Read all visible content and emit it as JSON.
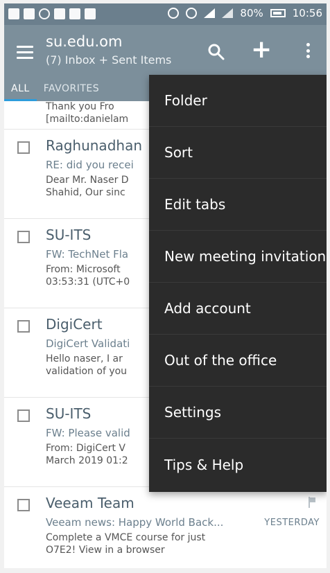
{
  "status_bar": {
    "battery": "80%",
    "time": "10:56",
    "icons": [
      "flipboard-icon",
      "flipboard-icon",
      "whatsapp-icon",
      "message-icon",
      "gmail-icon",
      "email-icon",
      "alarm-icon",
      "wifi-icon",
      "signal-icon",
      "signal-icon",
      "battery-icon"
    ]
  },
  "app_bar": {
    "account": "su.edu.om",
    "mailbox": "(7) Inbox + Sent Items",
    "icons": [
      "menu-icon",
      "search-icon",
      "add-icon",
      "more-vert-icon"
    ]
  },
  "tabs": [
    {
      "label": "ALL",
      "active": true
    },
    {
      "label": "FAVORITES",
      "active": false
    }
  ],
  "messages": {
    "partial": {
      "line1": "Thank you    Fro",
      "line2": "[mailto:danielam"
    },
    "items": [
      {
        "sender": "Raghunadhan",
        "subject": "RE: did you recei",
        "preview1": "Dear Mr. Naser D",
        "preview2": "Shahid,   Our sinc"
      },
      {
        "sender": "SU-ITS",
        "subject": "FW: TechNet Fla",
        "preview1": "From: Microsoft",
        "preview2": "03:53:31 (UTC+0"
      },
      {
        "sender": "DigiCert",
        "subject": "DigiCert Validati",
        "preview1": "Hello naser,   I ar",
        "preview2": "validation of you"
      },
      {
        "sender": "SU-ITS",
        "subject": "FW: Please valid",
        "preview1": "From: DigiCert V",
        "preview2": "March 2019 01:2"
      },
      {
        "sender": "Veeam Team",
        "subject": "Veeam news: Happy World Back...",
        "preview1": "Complete a VMCE course for just",
        "preview2": "O7E2! View in a browser",
        "date": "YESTERDAY",
        "flag_icon": "flag-icon"
      }
    ]
  },
  "menu": {
    "items": [
      "Folder",
      "Sort",
      "Edit tabs",
      "New meeting invitation",
      "Add account",
      "Out of the office",
      "Settings",
      "Tips & Help"
    ]
  },
  "colors": {
    "app_bar": "#7c8f9b",
    "status_bar": "#6b7f8d",
    "tab_indicator": "#2d9cdb",
    "menu_bg": "#2b2b2b"
  }
}
